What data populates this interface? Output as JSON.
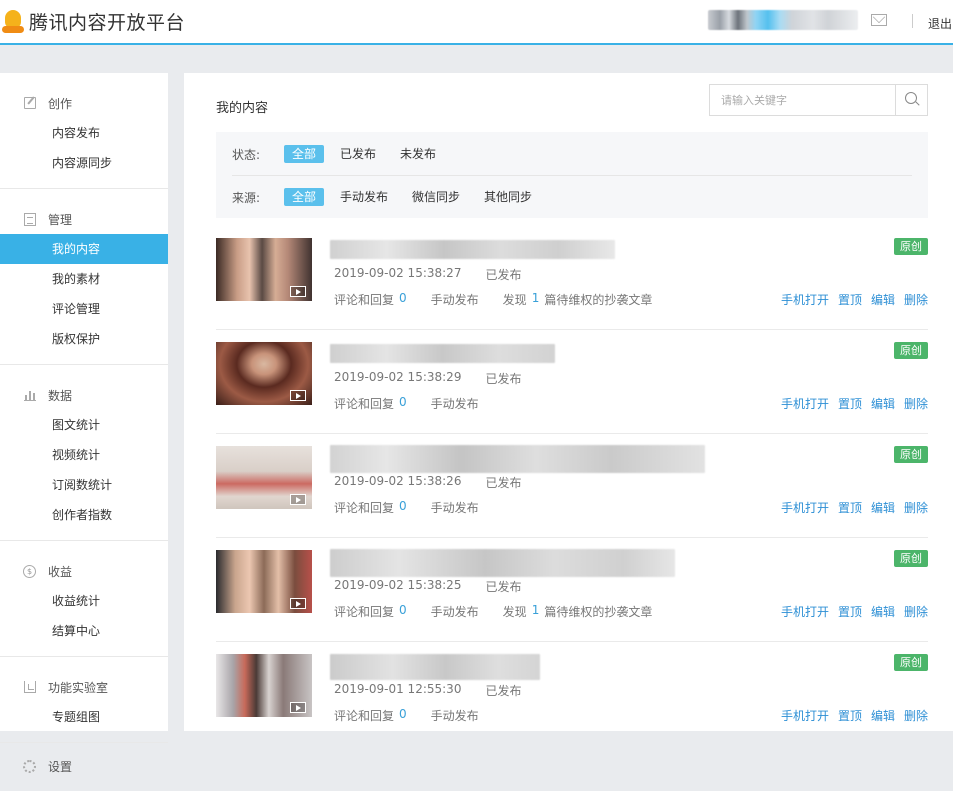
{
  "header": {
    "logo_text": "腾讯内容开放平台",
    "logout_label": "退出"
  },
  "sidebar": {
    "groups": [
      {
        "label": "创作",
        "icon": "edit-icon",
        "items": [
          "内容发布",
          "内容源同步"
        ]
      },
      {
        "label": "管理",
        "icon": "document-icon",
        "items": [
          "我的内容",
          "我的素材",
          "评论管理",
          "版权保护"
        ]
      },
      {
        "label": "数据",
        "icon": "bar-chart-icon",
        "items": [
          "图文统计",
          "视频统计",
          "订阅数统计",
          "创作者指数"
        ]
      },
      {
        "label": "收益",
        "icon": "coin-icon",
        "items": [
          "收益统计",
          "结算中心"
        ]
      },
      {
        "label": "功能实验室",
        "icon": "lab-icon",
        "items": [
          "专题组图"
        ]
      },
      {
        "label": "设置",
        "icon": "gear-icon",
        "items": []
      }
    ],
    "active_item": "我的内容"
  },
  "main": {
    "page_title": "我的内容",
    "search": {
      "placeholder": "请输入关键字",
      "value": ""
    },
    "filters": {
      "status": {
        "label": "状态:",
        "options": [
          "全部",
          "已发布",
          "未发布"
        ],
        "selected": "全部"
      },
      "source": {
        "label": "来源:",
        "options": [
          "全部",
          "手动发布",
          "微信同步",
          "其他同步"
        ],
        "selected": "全部"
      }
    },
    "items": [
      {
        "badge": "原创",
        "datetime": "2019-09-02 15:38:27",
        "status": "已发布",
        "comments_label": "评论和回复",
        "comments": "0",
        "source": "手动发布",
        "found_prefix": "发现",
        "found_count": "1",
        "found_suffix": "篇待维权的抄袭文章",
        "actions": [
          "手机打开",
          "置顶",
          "编辑",
          "删除"
        ]
      },
      {
        "badge": "原创",
        "datetime": "2019-09-02 15:38:29",
        "status": "已发布",
        "comments_label": "评论和回复",
        "comments": "0",
        "source": "手动发布",
        "actions": [
          "手机打开",
          "置顶",
          "编辑",
          "删除"
        ]
      },
      {
        "badge": "原创",
        "datetime": "2019-09-02 15:38:26",
        "status": "已发布",
        "comments_label": "评论和回复",
        "comments": "0",
        "source": "手动发布",
        "actions": [
          "手机打开",
          "置顶",
          "编辑",
          "删除"
        ]
      },
      {
        "badge": "原创",
        "datetime": "2019-09-02 15:38:25",
        "status": "已发布",
        "comments_label": "评论和回复",
        "comments": "0",
        "source": "手动发布",
        "found_prefix": "发现",
        "found_count": "1",
        "found_suffix": "篇待维权的抄袭文章",
        "actions": [
          "手机打开",
          "置顶",
          "编辑",
          "删除"
        ]
      },
      {
        "badge": "原创",
        "datetime": "2019-09-01 12:55:30",
        "status": "已发布",
        "comments_label": "评论和回复",
        "comments": "0",
        "source": "手动发布",
        "actions": [
          "手机打开",
          "置顶",
          "编辑",
          "删除"
        ]
      }
    ]
  },
  "colors": {
    "accent": "#39b1e6",
    "badge": "#4cb56a",
    "link": "#2d8fd5"
  }
}
